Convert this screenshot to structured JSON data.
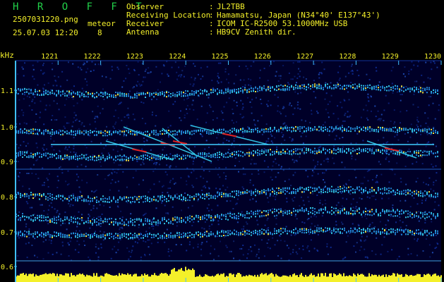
{
  "header": {
    "logo": "H R O F F T",
    "filename": "2507031220.png",
    "datetime": "25.07.03 12:20",
    "meteor_label": "meteor",
    "meteor_count": "8",
    "fields": [
      {
        "label": "Observer",
        "value": "JL2TBB"
      },
      {
        "label": "Receiving Location",
        "value": "Hamamatsu, Japan (N34°40' E137°43')"
      },
      {
        "label": "Receiver",
        "value": "ICOM IC-R2500 53.1000MHz USB"
      },
      {
        "label": "Antenna",
        "value": "HB9CV Zenith dir."
      }
    ],
    "colon": ":"
  },
  "spectrogram": {
    "y_unit": "kHz",
    "y_ticks": [
      "1.1",
      "1.0",
      "0.9",
      "0.8",
      "0.7",
      "0.6"
    ],
    "x_ticks": [
      "1221",
      "1222",
      "1223",
      "1224",
      "1225",
      "1226",
      "1227",
      "1228",
      "1229",
      "1230"
    ],
    "colors": {
      "background": "#000028",
      "noise": "#1030a0",
      "band": "#30c0e0",
      "hot": "#f0e040",
      "peak": "#e02020",
      "level": "#f4f02a",
      "axis": "#40c0ff"
    }
  }
}
